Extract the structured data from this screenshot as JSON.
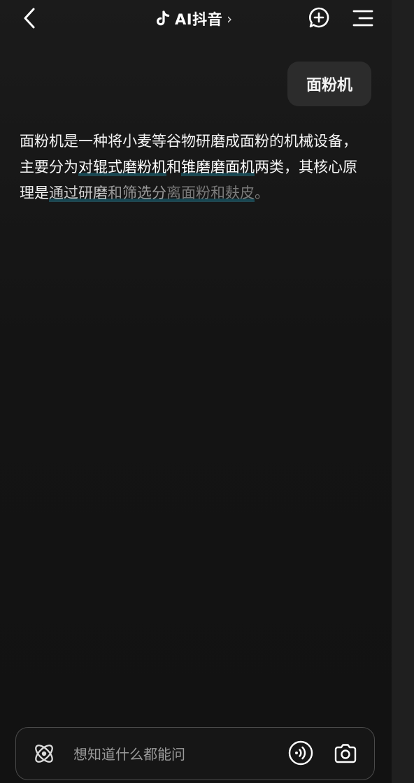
{
  "header": {
    "title": "AI抖音",
    "title_chevron": "›",
    "icons": [
      "back-icon",
      "tiktok-logo-icon",
      "new-chat-icon",
      "menu-icon"
    ]
  },
  "conversation": {
    "user_message": "面粉机",
    "answer": {
      "p1": "面粉机是一种将小麦等谷物研磨成面粉的机械设备，主要分为",
      "link1": "对辊式磨粉机",
      "p2": "和",
      "link2": "锥磨磨面机",
      "p3": "两类，其核心原理是",
      "link3_a": "通过研磨",
      "link3_b": "和筛选分",
      "link3_c": "离面粉和麸皮",
      "p4": "。"
    }
  },
  "input_bar": {
    "placeholder": "想知道什么都能问",
    "value": "",
    "icons": [
      "agent-orbit-icon",
      "voice-icon",
      "camera-icon"
    ]
  },
  "colors": {
    "background": "#141414",
    "bubble": "#2c2c2c",
    "link_underline": "#186e82",
    "placeholder": "#9a9a9a"
  }
}
